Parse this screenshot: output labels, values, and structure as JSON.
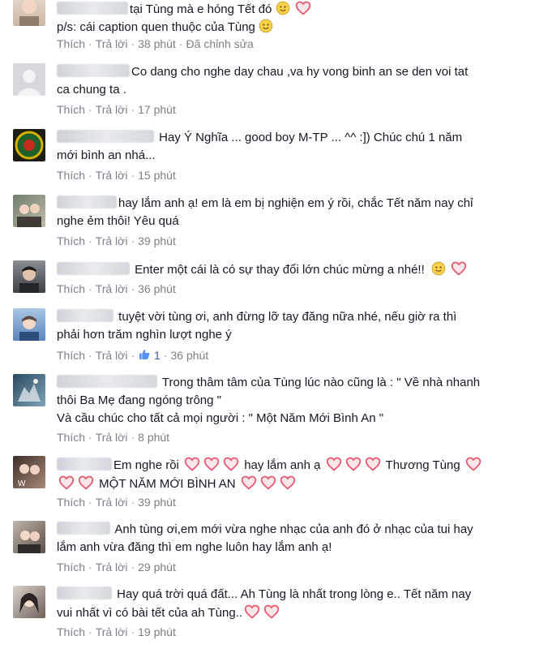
{
  "actions": {
    "like": "Thích",
    "reply": "Trả lời",
    "edited": "Đã chỉnh sửa"
  },
  "comments": [
    {
      "line1": "tại Tùng mà e hóng Tết đó",
      "line2": "p/s: cái caption quen thuộc của Tùng",
      "time": "38 phút"
    },
    {
      "line1": "Co dang cho nghe day chau ,va hy vong binh an se den voi tat",
      "line2": "ca chung ta .",
      "time": "17 phút"
    },
    {
      "line1": "Hay Ý Nghĩa ... good boy M-TP ... ^^ :]) Chúc chú 1 năm",
      "line2": "mới bình an nhá...",
      "time": "15 phút"
    },
    {
      "line1": "hay lắm anh ạ! em là em bị nghiện em ý rồi, chắc Tết năm nay chỉ",
      "line2": "nghe ẻm thôi! Yêu quá",
      "time": "39 phút"
    },
    {
      "line1": "Enter một cái là có sự thay đổi lớn chúc mừng a nhé!!",
      "time": "36 phút"
    },
    {
      "line1": "tuyệt vời tùng ơi, anh đừng lỡ tay đăng nữa nhé, nếu giờ ra thì",
      "line2": "phải hơn trăm nghìn lượt nghe ý",
      "likes": "1",
      "time": "36 phút"
    },
    {
      "line1": "Trong thâm tâm của Tùng lúc nào cũng là : \" Về nhà nhanh",
      "line2": "thôi Ba Mẹ đang ngóng trông \"",
      "line3": "Và cầu chúc cho tất cả mọi người : \" Một Năm Mới Bình An \"",
      "time": "8 phút"
    },
    {
      "line1a": "Em nghe rồi",
      "line1b": "hay lắm anh ạ",
      "line1c": "Thương Tùng",
      "line2": "MỘT NĂM MỚI BÌNH AN",
      "time": "39 phút"
    },
    {
      "line1": "Anh tùng ơi,em mới vừa nghe nhạc của anh đó ở nhạc của tui hay",
      "line2": "lắm anh vừa đăng thì em nghe luôn hay lắm anh ạ!",
      "time": "29 phút"
    },
    {
      "line1": "Hay quá trời quá đất... Ah Tùng là nhất trong lòng e.. Tết năm nay",
      "line2": "vui nhất vì có bài tết của ah Tùng..",
      "time": "19 phút"
    }
  ],
  "colors": {
    "heart": "#e9536b",
    "link": "#3b5998",
    "meta": "#9197a3"
  }
}
